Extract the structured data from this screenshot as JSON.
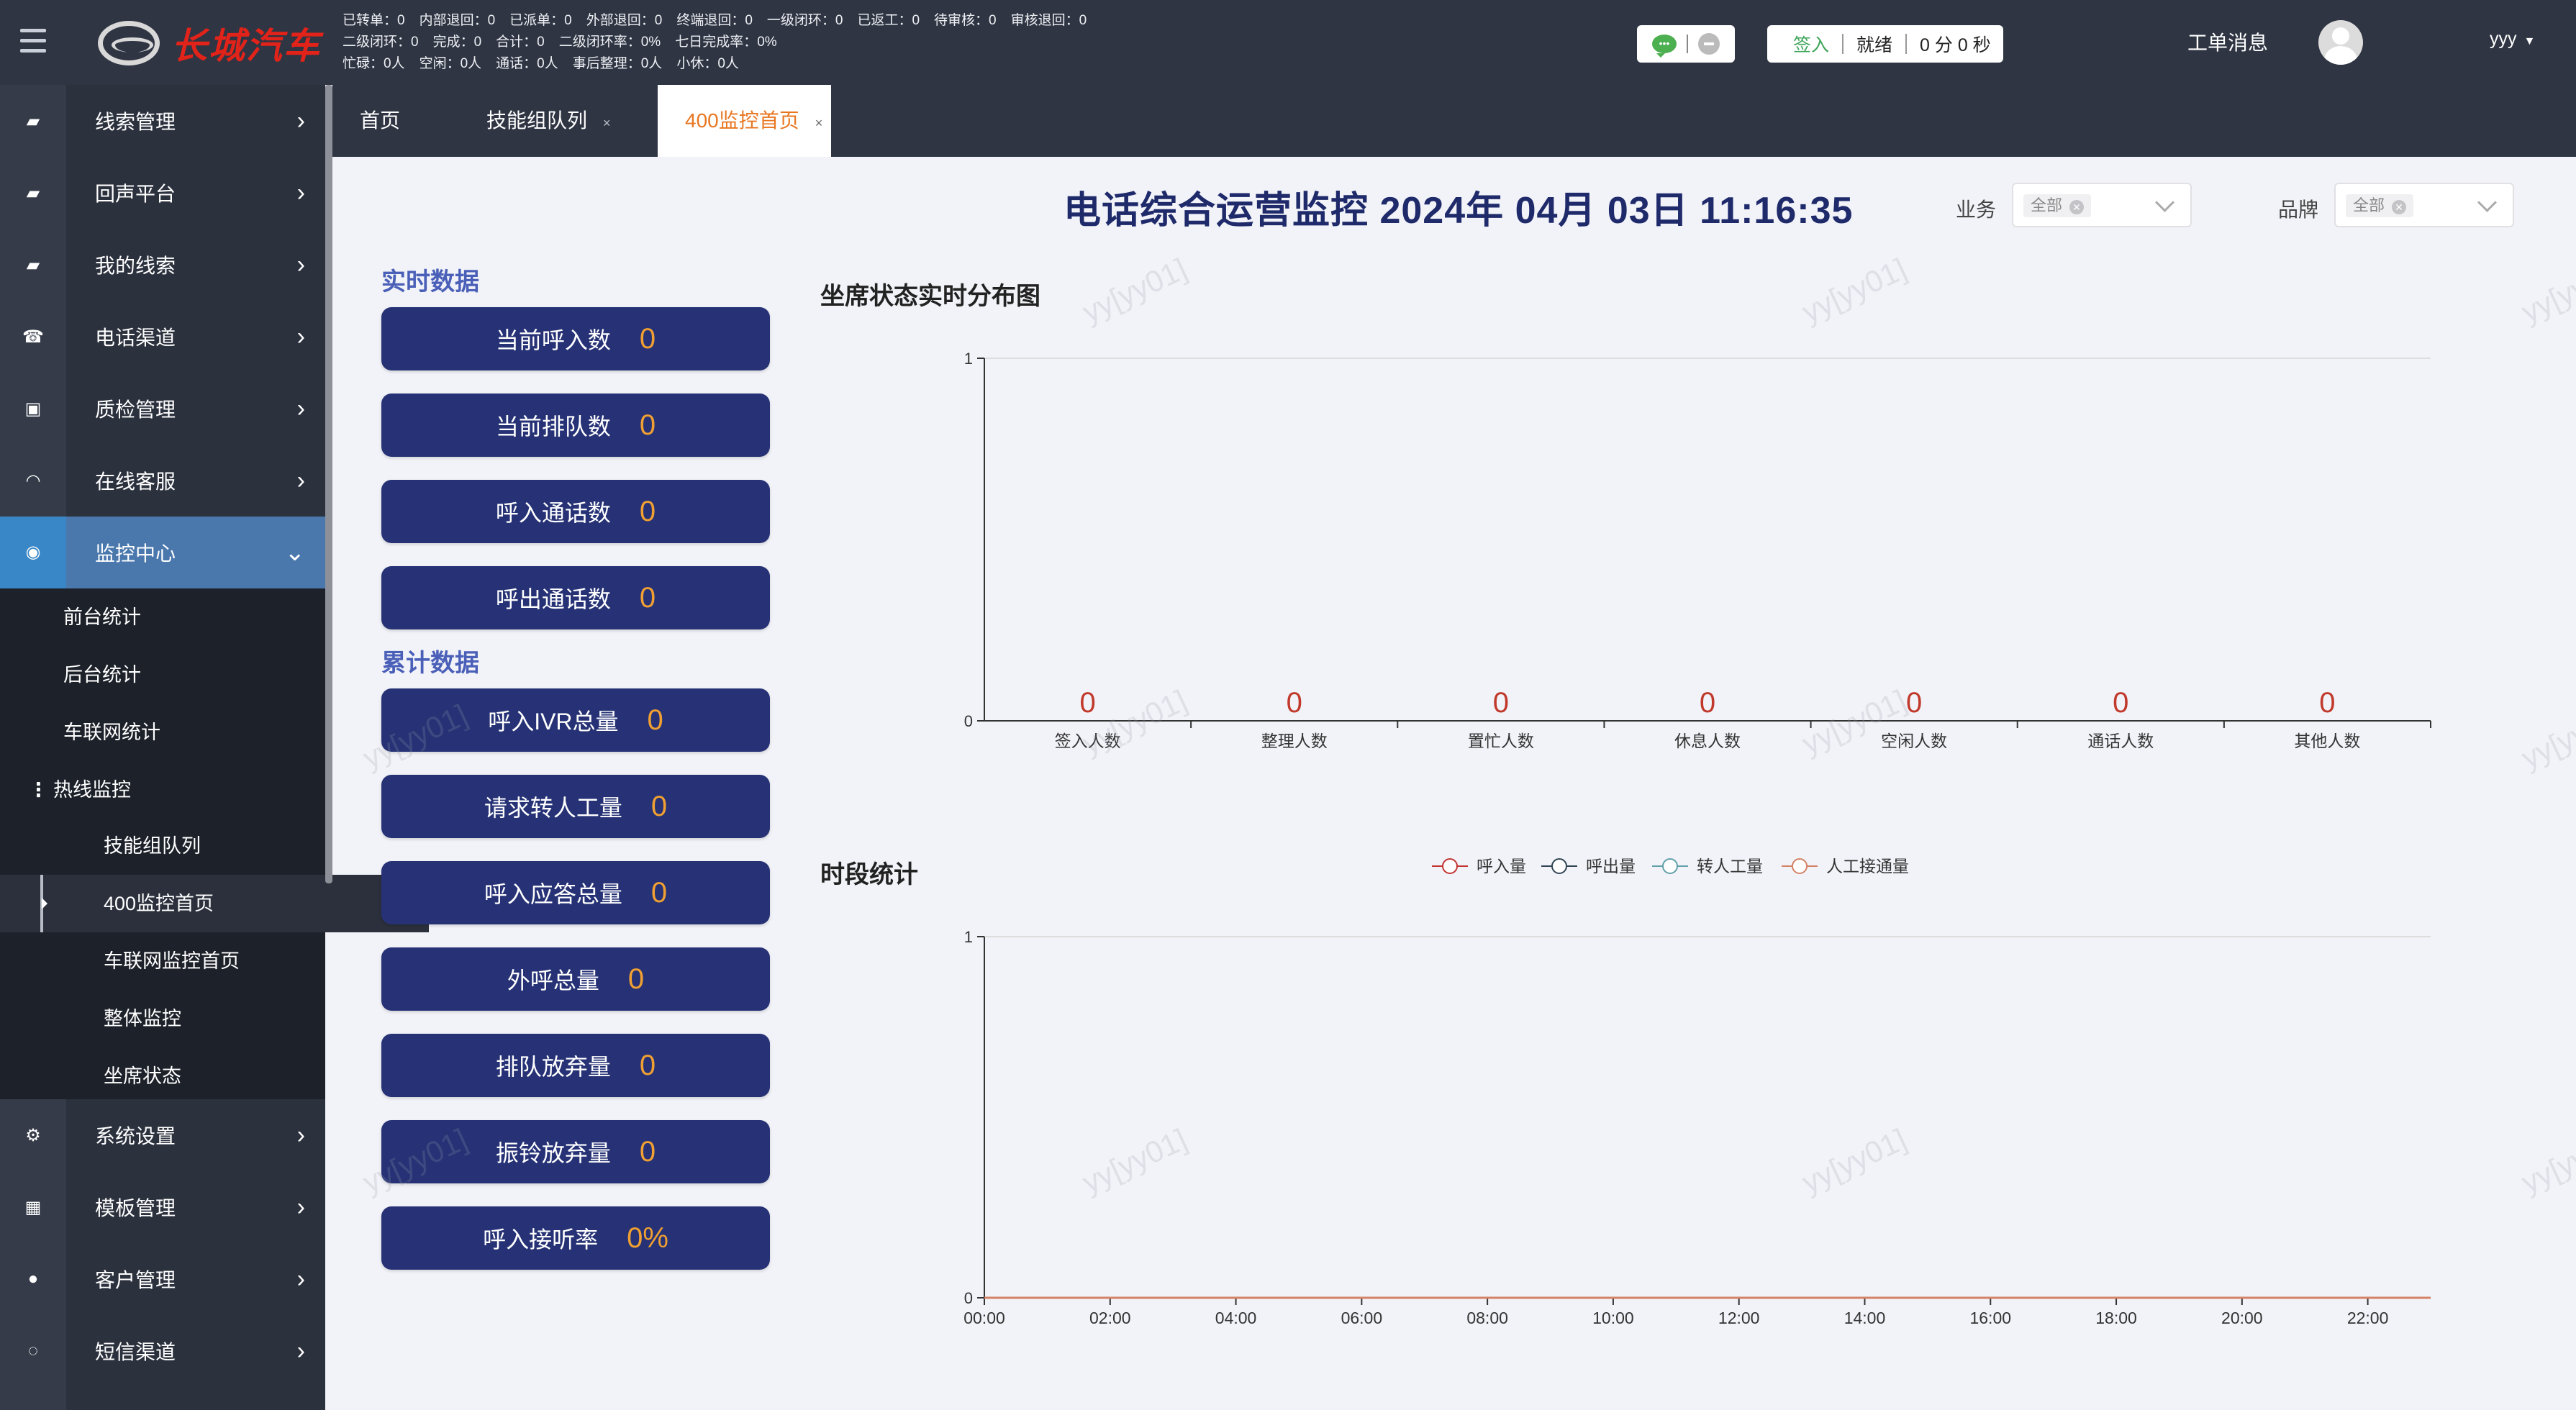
{
  "header": {
    "brand": "长城汽车",
    "stats_row1": [
      "已转单：0",
      "内部退回：0",
      "已派单：0",
      "外部退回：0",
      "终端退回：0",
      "一级闭环：0",
      "已返工：0",
      "待审核：0",
      "审核退回：0"
    ],
    "stats_row2": [
      "二级闭环：0",
      "完成：0",
      "合计：0",
      "二级闭环率：0%",
      "七日完成率：0%"
    ],
    "stats_row3": [
      "忙碌：0人",
      "空闲：0人",
      "通话：0人",
      "事后整理：0人",
      "小休：0人"
    ],
    "sign_in": "签入",
    "status": "就绪",
    "timer": "0 分 0 秒",
    "messages": "工单消息",
    "username": "yyy"
  },
  "sidebar": {
    "menu": [
      {
        "label": "线索管理",
        "icon": "book-icon"
      },
      {
        "label": "回声平台",
        "icon": "book-icon"
      },
      {
        "label": "我的线索",
        "icon": "book-icon"
      },
      {
        "label": "电话渠道",
        "icon": "phone-icon"
      },
      {
        "label": "质检管理",
        "icon": "archive-icon"
      },
      {
        "label": "在线客服",
        "icon": "headset-icon"
      },
      {
        "label": "监控中心",
        "icon": "eye-icon"
      }
    ],
    "sub_items": [
      "前台统计",
      "后台统计",
      "车联网统计"
    ],
    "group": "热线监控",
    "group_items": [
      "技能组队列",
      "400监控首页",
      "车联网监控首页",
      "整体监控",
      "坐席状态"
    ],
    "bottom_menu": [
      {
        "label": "系统设置",
        "icon": "gears-icon"
      },
      {
        "label": "模板管理",
        "icon": "grid-icon"
      },
      {
        "label": "客户管理",
        "icon": "user-circle-icon"
      },
      {
        "label": "短信渠道",
        "icon": "chat-icon"
      }
    ]
  },
  "tabs": [
    {
      "label": "首页"
    },
    {
      "label": "技能组队列",
      "close": "×"
    },
    {
      "label": "400监控首页",
      "close": "×"
    }
  ],
  "main": {
    "title": "电话综合运营监控 2024年 04月 03日  11:16:35",
    "filter_business_label": "业务",
    "filter_business_value": "全部",
    "filter_brand_label": "品牌",
    "filter_brand_value": "全部",
    "realtime_title": "实时数据",
    "realtime": [
      {
        "label": "当前呼入数",
        "value": "0"
      },
      {
        "label": "当前排队数",
        "value": "0"
      },
      {
        "label": "呼入通话数",
        "value": "0"
      },
      {
        "label": "呼出通话数",
        "value": "0"
      }
    ],
    "cumulative_title": "累计数据",
    "cumulative": [
      {
        "label": "呼入IVR总量",
        "value": "0"
      },
      {
        "label": "请求转人工量",
        "value": "0"
      },
      {
        "label": "呼入应答总量",
        "value": "0"
      },
      {
        "label": "外呼总量",
        "value": "0"
      },
      {
        "label": "排队放弃量",
        "value": "0"
      },
      {
        "label": "振铃放弃量",
        "value": "0"
      },
      {
        "label": "呼入接听率",
        "value": "0%"
      }
    ],
    "watermark": "yy[yy01]"
  },
  "chart_data": [
    {
      "type": "bar",
      "title": "坐席状态实时分布图",
      "categories": [
        "签入人数",
        "整理人数",
        "置忙人数",
        "休息人数",
        "空闲人数",
        "通话人数",
        "其他人数"
      ],
      "values": [
        0,
        0,
        0,
        0,
        0,
        0,
        0
      ],
      "ylim": [
        0,
        1
      ],
      "yticks": [
        "0",
        "1"
      ],
      "grid": true,
      "label_color": "#c0392b"
    },
    {
      "type": "line",
      "title": "时段统计",
      "x": [
        "00:00",
        "02:00",
        "04:00",
        "06:00",
        "08:00",
        "10:00",
        "12:00",
        "14:00",
        "16:00",
        "18:00",
        "20:00",
        "22:00"
      ],
      "series": [
        {
          "name": "呼入量",
          "color": "#c23531",
          "values": [
            0,
            0,
            0,
            0,
            0,
            0,
            0,
            0,
            0,
            0,
            0,
            0
          ]
        },
        {
          "name": "呼出量",
          "color": "#2f4554",
          "values": [
            0,
            0,
            0,
            0,
            0,
            0,
            0,
            0,
            0,
            0,
            0,
            0
          ]
        },
        {
          "name": "转人工量",
          "color": "#61a0a8",
          "values": [
            0,
            0,
            0,
            0,
            0,
            0,
            0,
            0,
            0,
            0,
            0,
            0
          ]
        },
        {
          "name": "人工接通量",
          "color": "#d48265",
          "values": [
            0,
            0,
            0,
            0,
            0,
            0,
            0,
            0,
            0,
            0,
            0,
            0
          ]
        }
      ],
      "ylim": [
        0,
        1
      ],
      "yticks": [
        "0",
        "1"
      ],
      "grid": true,
      "legend": "top-center"
    }
  ]
}
